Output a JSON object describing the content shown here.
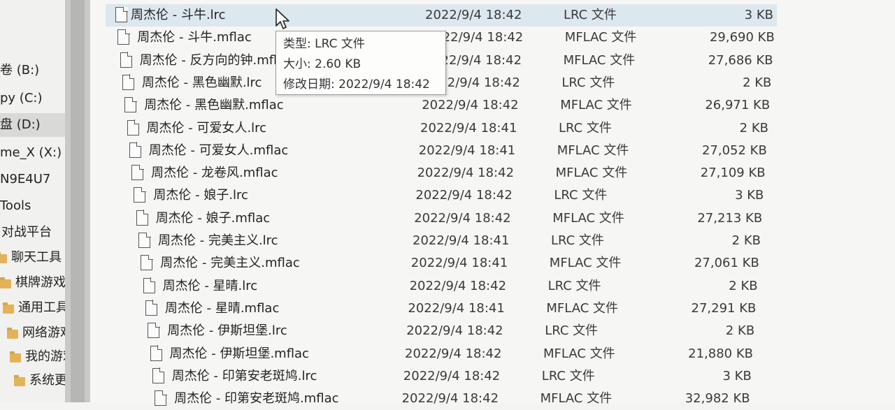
{
  "nav": {
    "items": [
      {
        "label": "卷 (B:)",
        "type": "drive",
        "selected": false
      },
      {
        "label": "py (C:)",
        "type": "drive",
        "selected": false
      },
      {
        "label": "盘 (D:)",
        "type": "drive",
        "selected": true
      },
      {
        "label": "me_X (X:)",
        "type": "drive",
        "selected": false
      },
      {
        "label": "N9E4U7",
        "type": "folder-text",
        "selected": false
      },
      {
        "label": "Tools",
        "type": "folder-text",
        "selected": false
      },
      {
        "label": "对战平台",
        "type": "folder-text",
        "selected": false
      },
      {
        "label": "聊天工具",
        "type": "folder",
        "selected": false
      },
      {
        "label": "棋牌游戏",
        "type": "folder",
        "selected": false
      },
      {
        "label": "通用工具",
        "type": "folder",
        "selected": false
      },
      {
        "label": "网络游戏",
        "type": "folder",
        "selected": false
      },
      {
        "label": "我的游戏",
        "type": "folder",
        "selected": false
      },
      {
        "label": "系统更新",
        "type": "folder",
        "selected": false
      }
    ]
  },
  "files": [
    {
      "name": "周杰伦 - 斗牛.lrc",
      "date": "2022/9/4 18:42",
      "type": "LRC 文件",
      "size": "3 KB",
      "selected": true
    },
    {
      "name": "周杰伦 - 斗牛.mflac",
      "date": "2022/9/4 18:42",
      "type": "MFLAC 文件",
      "size": "29,690 KB"
    },
    {
      "name": "周杰伦 - 反方向的钟.mflac",
      "date": "2022/9/4 18:42",
      "type": "MFLAC 文件",
      "size": "27,686 KB"
    },
    {
      "name": "周杰伦 - 黑色幽默.lrc",
      "date": "2022/9/4 18:42",
      "type": "LRC 文件",
      "size": "2 KB"
    },
    {
      "name": "周杰伦 - 黑色幽默.mflac",
      "date": "2022/9/4 18:42",
      "type": "MFLAC 文件",
      "size": "26,971 KB"
    },
    {
      "name": "周杰伦 - 可爱女人.lrc",
      "date": "2022/9/4 18:41",
      "type": "LRC 文件",
      "size": "2 KB"
    },
    {
      "name": "周杰伦 - 可爱女人.mflac",
      "date": "2022/9/4 18:41",
      "type": "MFLAC 文件",
      "size": "27,052 KB"
    },
    {
      "name": "周杰伦 - 龙卷风.mflac",
      "date": "2022/9/4 18:42",
      "type": "MFLAC 文件",
      "size": "27,109 KB"
    },
    {
      "name": "周杰伦 - 娘子.lrc",
      "date": "2022/9/4 18:42",
      "type": "LRC 文件",
      "size": "3 KB"
    },
    {
      "name": "周杰伦 - 娘子.mflac",
      "date": "2022/9/4 18:42",
      "type": "MFLAC 文件",
      "size": "27,213 KB"
    },
    {
      "name": "周杰伦 - 完美主义.lrc",
      "date": "2022/9/4 18:41",
      "type": "LRC 文件",
      "size": "2 KB"
    },
    {
      "name": "周杰伦 - 完美主义.mflac",
      "date": "2022/9/4 18:41",
      "type": "MFLAC 文件",
      "size": "27,061 KB"
    },
    {
      "name": "周杰伦 - 星晴.lrc",
      "date": "2022/9/4 18:42",
      "type": "LRC 文件",
      "size": "2 KB"
    },
    {
      "name": "周杰伦 - 星晴.mflac",
      "date": "2022/9/4 18:41",
      "type": "MFLAC 文件",
      "size": "27,291 KB"
    },
    {
      "name": "周杰伦 - 伊斯坦堡.lrc",
      "date": "2022/9/4 18:42",
      "type": "LRC 文件",
      "size": "2 KB"
    },
    {
      "name": "周杰伦 - 伊斯坦堡.mflac",
      "date": "2022/9/4 18:42",
      "type": "MFLAC 文件",
      "size": "21,880 KB"
    },
    {
      "name": "周杰伦 - 印第安老斑鸠.lrc",
      "date": "2022/9/4 18:42",
      "type": "LRC 文件",
      "size": "3 KB"
    },
    {
      "name": "周杰伦 - 印第安老斑鸠.mflac",
      "date": "2022/9/4 18:42",
      "type": "MFLAC 文件",
      "size": "32,982 KB"
    }
  ],
  "tooltip": {
    "type_line": "类型: LRC 文件",
    "size_line": "大小: 2.60 KB",
    "modified_line": "修改日期: 2022/9/4 18:42"
  },
  "colors": {
    "selected_row": "#dde7ee",
    "selected_nav": "#d9d9d7",
    "folder": "#e3b35a"
  }
}
